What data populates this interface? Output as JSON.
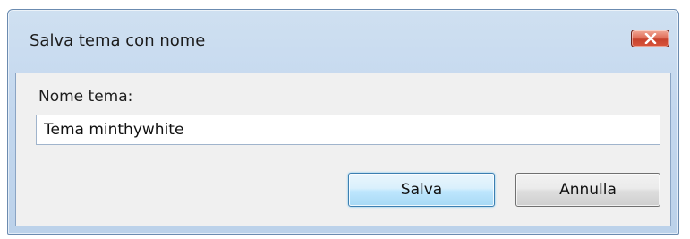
{
  "dialog": {
    "title": "Salva tema con nome",
    "close_icon": "close-icon",
    "field_label": "Nome tema:",
    "field_value": "Tema minthywhite",
    "save_label": "Salva",
    "cancel_label": "Annulla"
  },
  "colors": {
    "titlebar": "#c3d7ee",
    "close_button": "#c7432d",
    "client_background": "#f0f0f0",
    "primary_button_border": "#3c7fb1"
  }
}
